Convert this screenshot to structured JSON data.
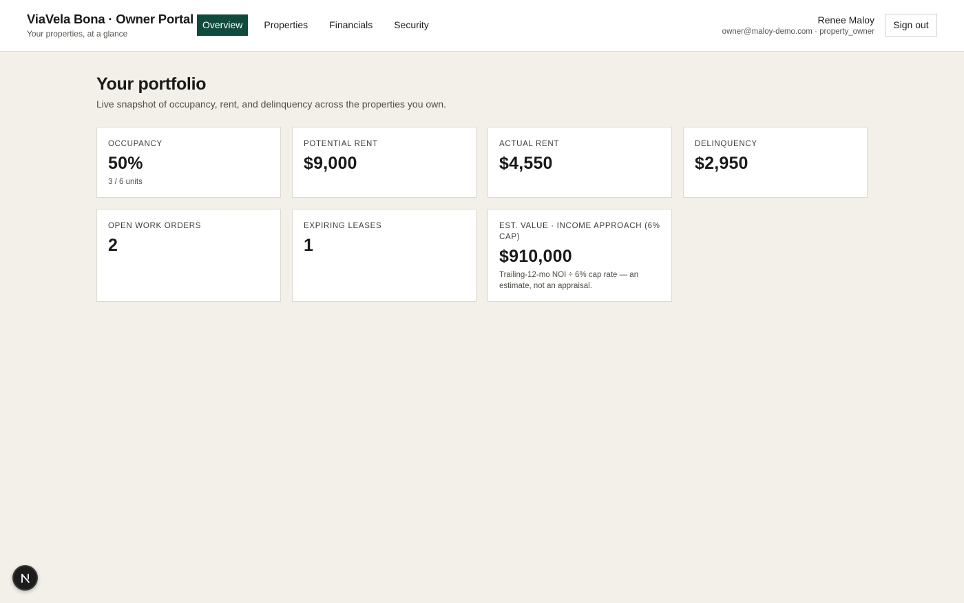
{
  "header": {
    "brand_title": "ViaVela Bona · Owner Portal",
    "brand_subtitle": "Your properties, at a glance",
    "nav": [
      {
        "label": "Overview",
        "active": true
      },
      {
        "label": "Properties",
        "active": false
      },
      {
        "label": "Financials",
        "active": false
      },
      {
        "label": "Security",
        "active": false
      }
    ],
    "user_name": "Renee Maloy",
    "user_meta": "owner@maloy-demo.com · property_owner",
    "signout_label": "Sign out"
  },
  "main": {
    "title": "Your portfolio",
    "subtitle": "Live snapshot of occupancy, rent, and delinquency across the properties you own.",
    "cards": [
      {
        "label": "Occupancy",
        "value": "50%",
        "note": "3 / 6 units"
      },
      {
        "label": "Potential rent",
        "value": "$9,000",
        "note": ""
      },
      {
        "label": "Actual rent",
        "value": "$4,550",
        "note": ""
      },
      {
        "label": "Delinquency",
        "value": "$2,950",
        "note": ""
      },
      {
        "label": "Open work orders",
        "value": "2",
        "note": ""
      },
      {
        "label": "Expiring leases",
        "value": "1",
        "note": ""
      },
      {
        "label": "Est. value · income approach (6% cap)",
        "value": "$910,000",
        "note": "Trailing-12-mo NOI ÷ 6% cap rate — an estimate, not an appraisal."
      }
    ]
  },
  "fab": {
    "icon": "n-logo-icon",
    "letter": "N"
  },
  "colors": {
    "accent": "#0f4a3c",
    "background": "#f2f0e8"
  }
}
